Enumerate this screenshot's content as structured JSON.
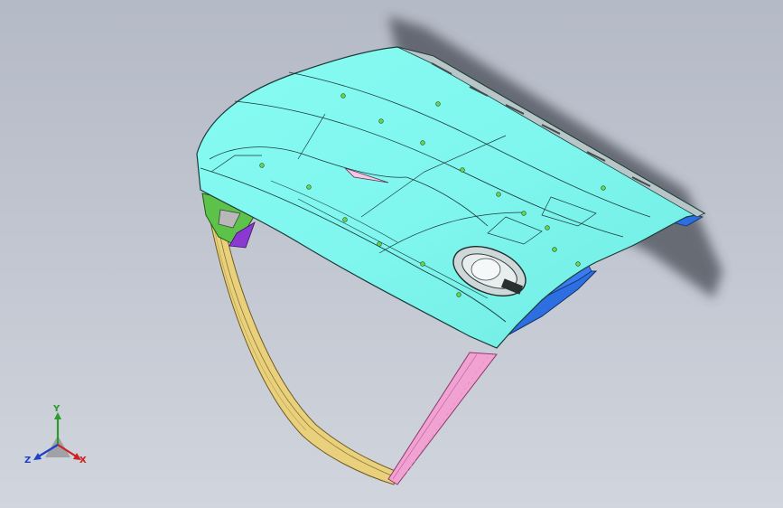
{
  "viewport": {
    "background_top": "#b4bac6",
    "background_bottom": "#d1d5dd"
  },
  "model": {
    "panel_color": "#80fbf0",
    "frame_left_color": "#e8d07c",
    "frame_right_color": "#f2a2d2",
    "inner_structure_color": "#2d6fe0",
    "bracket_color": "#5cc24a",
    "shadow_color": "#4a4d57"
  },
  "triad": {
    "y_label": "Y",
    "x_label": "X",
    "z_label": "Z",
    "y_color": "#2a9c2a",
    "x_color": "#d02020",
    "z_color": "#2040c8"
  }
}
